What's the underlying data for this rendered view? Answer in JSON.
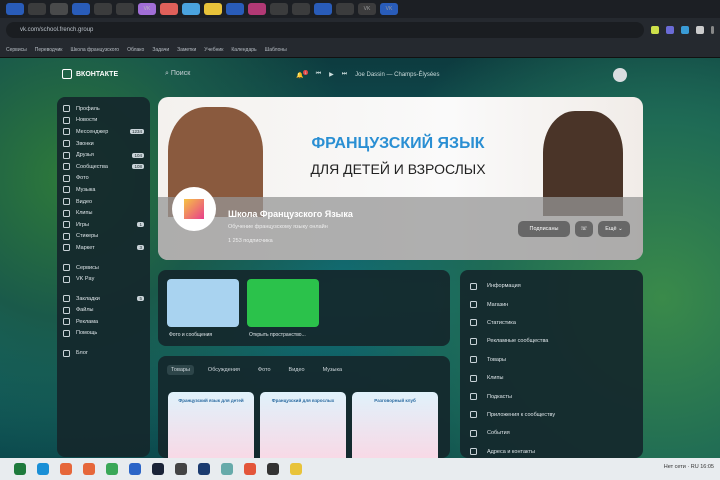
{
  "browser": {
    "url": "vk.com/school.french.group",
    "tabs": [
      "",
      "",
      "",
      "",
      "",
      "",
      "VK",
      "",
      "",
      "",
      "",
      "",
      "",
      "",
      "",
      "",
      "VK",
      "VK"
    ],
    "tab_colors": [
      "#2d6cdf",
      "#444",
      "#555",
      "#2d6cdf",
      "#444",
      "#444",
      "#a16ed6",
      "#e0605a",
      "#4aa3df",
      "#e8c33a",
      "#2d6cdf",
      "#d8408a",
      "#444",
      "#444",
      "#2d6cdf",
      "#444",
      "#444",
      "#2d6cdf"
    ],
    "bookmarks": [
      "Сервисы",
      "Переводчик",
      "Школа французского",
      "Облако",
      "Задачи",
      "Заметки",
      "Учебник",
      "Календарь",
      "Шаблоны"
    ]
  },
  "vk": {
    "logo": "ВКОНТАКТЕ",
    "search": "Поиск",
    "now_playing": "Joe Dassin — Champs-Élysées",
    "notification_count": "1"
  },
  "sidebar": {
    "items": [
      {
        "label": "Профиль"
      },
      {
        "label": "Новости"
      },
      {
        "label": "Мессенджер",
        "count": "1234"
      },
      {
        "label": "Звонки"
      },
      {
        "label": "Друзья",
        "count": "104"
      },
      {
        "label": "Сообщества",
        "count": "108"
      },
      {
        "label": "Фото"
      },
      {
        "label": "Музыка"
      },
      {
        "label": "Видео"
      },
      {
        "label": "Клипы"
      },
      {
        "label": "Игры",
        "count": "1"
      },
      {
        "label": "Стикеры"
      },
      {
        "label": "Маркет",
        "count": "3"
      }
    ],
    "items2": [
      {
        "label": "Сервисы"
      },
      {
        "label": "VK Pay"
      }
    ],
    "items3": [
      {
        "label": "Закладки",
        "count": "5"
      },
      {
        "label": "Файлы"
      },
      {
        "label": "Реклама"
      },
      {
        "label": "Помощь"
      }
    ],
    "footer": "Блог"
  },
  "banner": {
    "line1": "ФРАНЦУЗСКИЙ ЯЗЫК",
    "line2": "ДЛЯ ДЕТЕЙ И ВЗРОСЛЫХ",
    "group_name": "Школа Французского Языка",
    "subtitle": "Обучение французскому языку онлайн",
    "members": "1 253 подписчика",
    "subscribed": "Подписаны",
    "more": "Ещё"
  },
  "cards": [
    {
      "label": "Фото и сообщения",
      "color": "#a9d3f0"
    },
    {
      "label": "Открыть пространство...",
      "color": "#2bc24b"
    }
  ],
  "goods": {
    "tabs": [
      "Товары",
      "Обсуждения",
      "Фото",
      "Видео",
      "Музыка"
    ],
    "products": [
      "Французский язык для детей",
      "Французский для взрослых",
      "Разговорный клуб"
    ]
  },
  "right_menu": [
    "Информация",
    "Магазин",
    "Статистика",
    "Рекламные сообщества",
    "Товары",
    "Клипы",
    "Подкасты",
    "Приложения к сообществу",
    "События",
    "Адреса и контакты"
  ],
  "taskbar": {
    "colors": [
      "#1e7a3c",
      "#1a8fd6",
      "#e6673a",
      "#e6673a",
      "#3aa757",
      "#2b64c7",
      "#1b2438",
      "#444",
      "#1b3b6f",
      "#6aa",
      "#e3553a",
      "#333",
      "#e8c33a"
    ],
    "tray": "Нет сети · RU 16:05"
  }
}
